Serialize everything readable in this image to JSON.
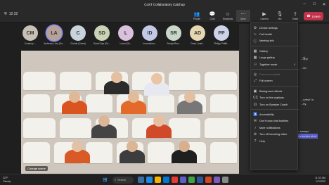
{
  "window": {
    "title": "CoST Collaboratory Catchup",
    "controls": [
      "–",
      "□",
      "✕"
    ]
  },
  "toolbar": {
    "timer": "12:32",
    "buttons": [
      {
        "label": "People",
        "icon": "people-icon"
      },
      {
        "label": "Chat",
        "icon": "chat-icon"
      },
      {
        "label": "Reactions",
        "icon": "reactions-icon"
      },
      {
        "label": "More",
        "icon": "more-icon"
      },
      {
        "label": "Camera",
        "icon": "camera-icon"
      },
      {
        "label": "Mic",
        "icon": "mic-icon"
      },
      {
        "label": "Share",
        "icon": "share-icon"
      }
    ],
    "leave_label": "Leave"
  },
  "participants": [
    {
      "initials": "CM",
      "name": "Courtney ...",
      "color": "#c8c0b5"
    },
    {
      "initials": "LA",
      "name": "Anderson, Lea (Gu...",
      "color": "#b7a29a"
    },
    {
      "initials": "C",
      "name": "Clodde (Guest)",
      "color": "#c9d3dc"
    },
    {
      "initials": "SD",
      "name": "Sarah Dye (Gu...",
      "color": "#c8d4b5"
    },
    {
      "initials": "L",
      "name": "Laura (Gu...",
      "color": "#d9c0dc"
    },
    {
      "initials": "ID",
      "name": "Innovationa...",
      "color": "#c3c8e6"
    },
    {
      "initials": "SR",
      "name": "Svenja Rea...",
      "color": "#c9d7c9"
    },
    {
      "initials": "AD",
      "name": "Dean, Austi...",
      "color": "#e6d7b3"
    },
    {
      "initials": "PP",
      "name": "Philipp Pettitt...",
      "color": "#cfd3e8"
    }
  ],
  "stage": {
    "label": "Change scene"
  },
  "chat_fragments": [
    "...rt",
    "...ary!",
    "...fid",
    "...rview\" is",
    "...ity.",
    "...d it, sweep!",
    "...to a screen shot"
  ],
  "menu": {
    "items": [
      {
        "label": "Device settings",
        "icon": "gear-icon",
        "enabled": true
      },
      {
        "label": "Call health",
        "icon": "pulse-icon",
        "enabled": true
      },
      {
        "label": "Meeting info",
        "icon": "info-icon",
        "enabled": true
      },
      {
        "sep": true
      },
      {
        "label": "Gallery",
        "icon": "grid-icon",
        "enabled": true
      },
      {
        "label": "Large gallery",
        "icon": "large-grid-icon",
        "enabled": true
      },
      {
        "label": "Together mode",
        "icon": "together-icon",
        "enabled": true,
        "checked": true
      },
      {
        "sep": true
      },
      {
        "label": "Focus on content",
        "icon": "focus-icon",
        "enabled": false
      },
      {
        "label": "Full screen",
        "icon": "fullscreen-icon",
        "enabled": true
      },
      {
        "sep": true
      },
      {
        "label": "Background effects",
        "icon": "background-icon",
        "enabled": true
      },
      {
        "label": "Turn on live captions",
        "icon": "captions-icon",
        "enabled": true
      },
      {
        "label": "Turn on Speaker Coach",
        "icon": "coach-icon",
        "enabled": true
      },
      {
        "sep": true
      },
      {
        "label": "Accessibility",
        "icon": "accessibility-icon",
        "enabled": true
      },
      {
        "label": "Don't show chat bubbles",
        "icon": "chat-bubble-icon",
        "enabled": true
      },
      {
        "label": "Mute notifications",
        "icon": "bell-icon",
        "enabled": true
      },
      {
        "label": "Turn off incoming video",
        "icon": "video-off-icon",
        "enabled": true
      },
      {
        "label": "Help",
        "icon": "help-icon",
        "enabled": true
      }
    ]
  },
  "taskbar": {
    "weather_temp": "32°F",
    "weather_desc": "Cloudy",
    "search_label": "Search",
    "time": "11:32 AM",
    "date": "1/7/2022"
  }
}
